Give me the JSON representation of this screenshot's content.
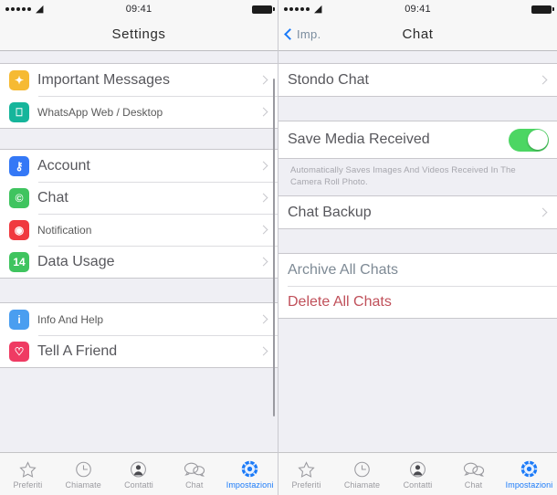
{
  "status_bar": {
    "signal_dots": 5,
    "wifi_icon": "wifi-icon",
    "time": "09:41",
    "battery_icon": "battery-icon"
  },
  "left_screen": {
    "nav": {
      "title": "Settings"
    },
    "groups": [
      {
        "rows": [
          {
            "icon": "star-icon",
            "icon_color": "#f6ba33",
            "icon_glyph": "★",
            "label": "Important Messages",
            "accessory": "chevron-right-icon",
            "size": "big"
          },
          {
            "icon": "monitor-icon",
            "icon_color": "#16b59b",
            "icon_glyph": "▣",
            "label": "WhatsApp Web / Desktop",
            "accessory": "chevron-right-icon",
            "size": "small"
          }
        ]
      },
      {
        "rows": [
          {
            "icon": "key-icon",
            "icon_color": "#3478f6",
            "icon_glyph": "⚷",
            "label": "Account",
            "accessory": "chevron-right-icon",
            "size": "big"
          },
          {
            "icon": "chat-bubble-icon",
            "icon_color": "#3fc45f",
            "icon_glyph": "©",
            "label": "Chat",
            "accessory": "chevron-right-icon",
            "size": "big"
          },
          {
            "icon": "bell-icon",
            "icon_color": "#f0393f",
            "icon_glyph": "■",
            "label": "Notification",
            "accessory": "chevron-right-icon",
            "size": "small"
          },
          {
            "icon": "data-usage-icon",
            "icon_color": "#3fc45f",
            "icon_glyph": "14",
            "label": "Data Usage",
            "accessory": "chevron-right-icon",
            "size": "big"
          }
        ]
      },
      {
        "rows": [
          {
            "icon": "info-icon",
            "icon_color": "#4a9ef0",
            "icon_glyph": "i",
            "label": "Info And Help",
            "accessory": "chevron-right-icon",
            "size": "small"
          },
          {
            "icon": "heart-icon",
            "icon_color": "#ef3b63",
            "icon_glyph": "♡",
            "label": "Tell A Friend",
            "accessory": "chevron-right-icon",
            "size": "big"
          }
        ]
      }
    ]
  },
  "right_screen": {
    "nav": {
      "back_label": "Imp.",
      "back_icon": "chevron-left-icon",
      "title": "Chat"
    },
    "group_wallpaper": {
      "row_label": "Stondo Chat",
      "accessory": "chevron-right-icon"
    },
    "group_media": {
      "row_label": "Save Media Received",
      "toggle_on": true,
      "toggle_color": "#4cd663",
      "footnote": "Automatically Saves Images And Videos Received In The Camera Roll Photo."
    },
    "group_backup": {
      "row_label": "Chat Backup",
      "accessory": "chevron-right-icon"
    },
    "group_actions": {
      "archive_label": "Archive All Chats",
      "archive_color": "#7e8a95",
      "delete_label": "Delete All Chats",
      "delete_color": "#c0505a"
    }
  },
  "tab_bar": {
    "items": [
      {
        "icon": "star-outline-icon",
        "label": "Preferiti",
        "active": false
      },
      {
        "icon": "clock-icon",
        "label": "Chiamate",
        "active": false
      },
      {
        "icon": "person-icon",
        "label": "Contatti",
        "active": false
      },
      {
        "icon": "chat-bubbles-icon",
        "label": "Chat",
        "active": false
      },
      {
        "icon": "gear-icon",
        "label": "Impostazioni",
        "active": true
      }
    ],
    "active_color": "#1a7af8",
    "inactive_color": "#9b9ba0"
  }
}
